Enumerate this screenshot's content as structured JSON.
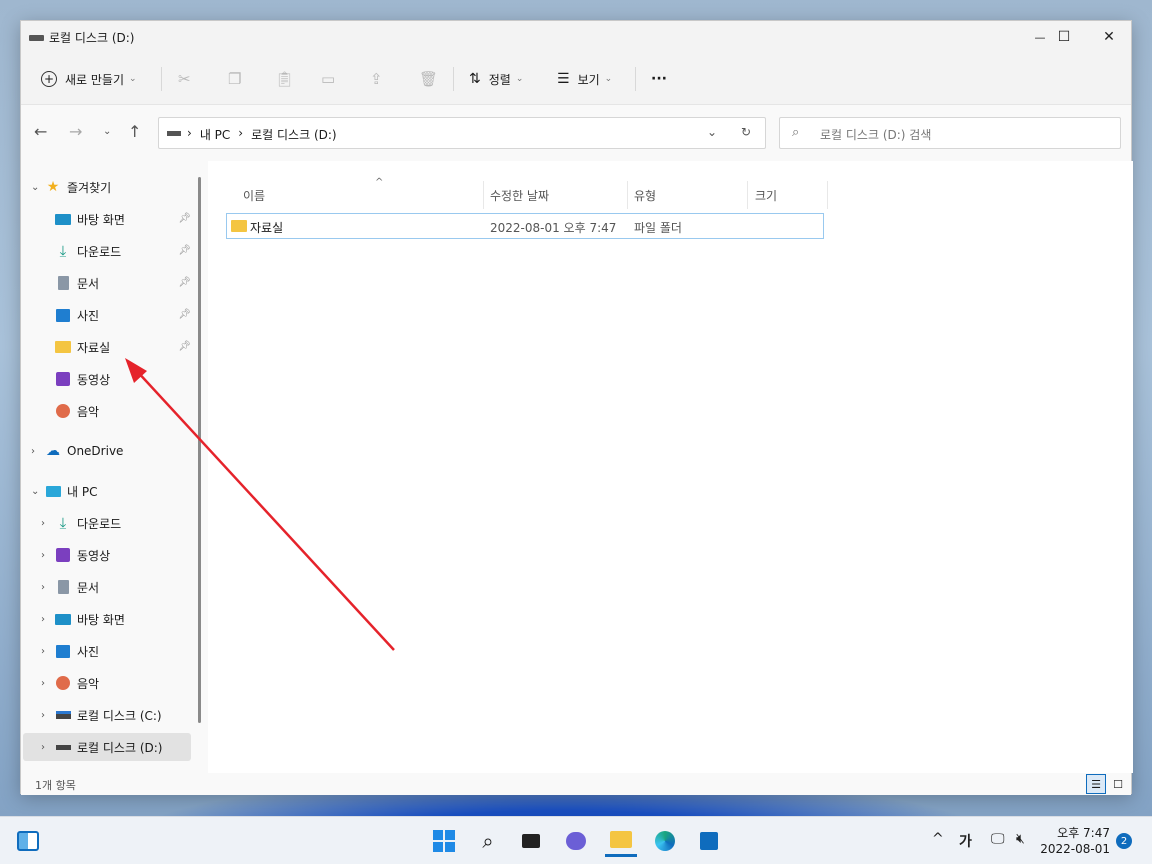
{
  "window": {
    "title": "로컬 디스크 (D:)",
    "minimize_glyph": "—",
    "maximize_glyph": "☐",
    "close_glyph": "✕"
  },
  "toolbar": {
    "new_label": "새로 만들기",
    "sort_label": "정렬",
    "view_label": "보기",
    "more_glyph": "···",
    "icons": [
      "cut-icon",
      "copy-icon",
      "paste-icon",
      "rename-icon",
      "share-icon",
      "delete-icon"
    ]
  },
  "nav": {
    "breadcrumb": [
      "내 PC",
      "로컬 디스크 (D:)"
    ],
    "search_placeholder": "로컬 디스크 (D:) 검색"
  },
  "sidebar": {
    "favorites_label": "즐겨찾기",
    "favorites": [
      {
        "label": "바탕 화면",
        "icon": "desktop-icon",
        "pinned": true
      },
      {
        "label": "다운로드",
        "icon": "download-icon",
        "pinned": true
      },
      {
        "label": "문서",
        "icon": "document-icon",
        "pinned": true
      },
      {
        "label": "사진",
        "icon": "pictures-icon",
        "pinned": true
      },
      {
        "label": "자료실",
        "icon": "folder-icon",
        "pinned": true
      },
      {
        "label": "동영상",
        "icon": "videos-icon",
        "pinned": false
      },
      {
        "label": "음악",
        "icon": "music-icon",
        "pinned": false
      }
    ],
    "onedrive_label": "OneDrive",
    "thispc_label": "내 PC",
    "thispc": [
      {
        "label": "다운로드",
        "icon": "download-icon"
      },
      {
        "label": "동영상",
        "icon": "videos-icon"
      },
      {
        "label": "문서",
        "icon": "document-icon"
      },
      {
        "label": "바탕 화면",
        "icon": "desktop-icon"
      },
      {
        "label": "사진",
        "icon": "pictures-icon"
      },
      {
        "label": "음악",
        "icon": "music-icon"
      },
      {
        "label": "로컬 디스크 (C:)",
        "icon": "windows-drive-icon"
      },
      {
        "label": "로컬 디스크 (D:)",
        "icon": "drive-icon",
        "selected": true
      }
    ]
  },
  "file_list": {
    "columns": [
      "이름",
      "수정한 날짜",
      "유형",
      "크기"
    ],
    "rows": [
      {
        "name": "자료실",
        "modified": "2022-08-01 오후 7:47",
        "type": "파일 폴더",
        "size": ""
      }
    ]
  },
  "status": {
    "item_count": "1개 항목"
  },
  "taskbar": {
    "time": "오후 7:47",
    "date": "2022-08-01",
    "notification_count": "2",
    "ime_label": "가"
  },
  "colors": {
    "accent": "#0f6cbd",
    "folder": "#f4c542",
    "annotation_arrow": "#e5232b"
  }
}
